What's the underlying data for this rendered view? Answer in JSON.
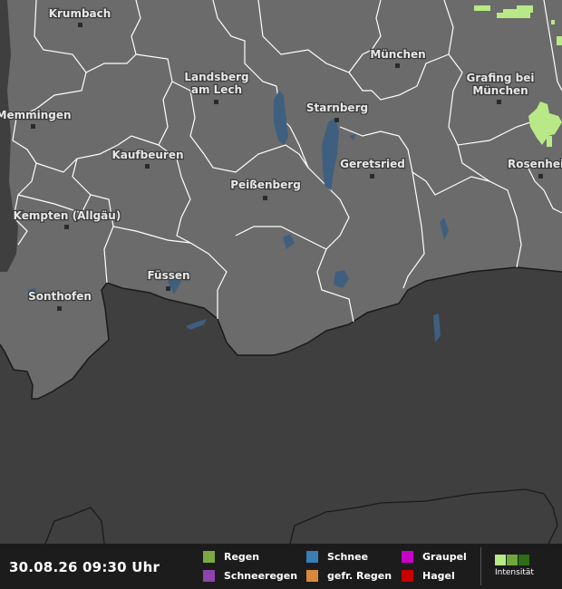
{
  "map": {
    "cities": [
      {
        "name": "Krumbach"
      },
      {
        "name": "Memmingen"
      },
      {
        "name": "Kaufbeuren"
      },
      {
        "name": "Kempten (Allgäu)"
      },
      {
        "name": "Sonthofen"
      },
      {
        "name": "Füssen"
      },
      {
        "name": "Landsberg am Lech"
      },
      {
        "name": "Peißenberg"
      },
      {
        "name": "Starnberg"
      },
      {
        "name": "Geretsried"
      },
      {
        "name": "München"
      },
      {
        "name": "Grafing bei München"
      },
      {
        "name": "Rosenheim"
      }
    ],
    "colors": {
      "land": "#6b6b6b",
      "foreign_land": "#3f3f3f",
      "borders": "#ffffff",
      "water": "#3f5f7f",
      "rain_light": "#b8e986"
    }
  },
  "footer": {
    "timestamp": "30.08.26 09:30 Uhr",
    "legend": [
      {
        "label": "Regen",
        "color": "#7aa843"
      },
      {
        "label": "Schneeregen",
        "color": "#8e44ad"
      },
      {
        "label": "Schnee",
        "color": "#3a7fb4"
      },
      {
        "label": "gefr. Regen",
        "color": "#d68a3a"
      },
      {
        "label": "Graupel",
        "color": "#c800c8"
      },
      {
        "label": "Hagel",
        "color": "#c80000"
      }
    ],
    "intensity": {
      "label": "Intensität",
      "colors": [
        "#b8e986",
        "#6fa83a",
        "#2f6d16"
      ]
    }
  }
}
